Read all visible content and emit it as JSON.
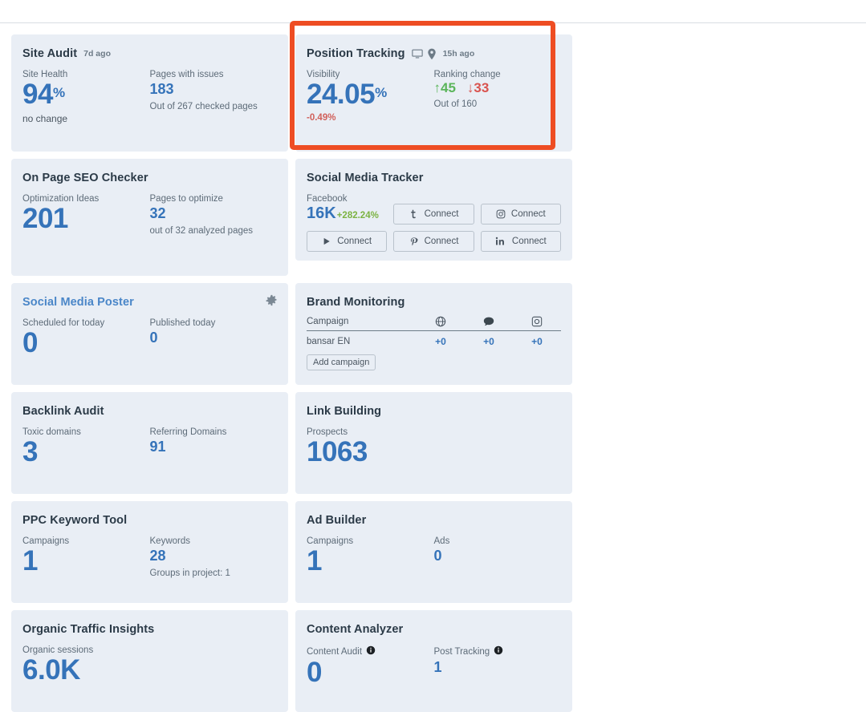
{
  "cards": [
    {
      "id": "site-audit",
      "title": "Site Audit",
      "meta": "7d ago",
      "metrics": [
        {
          "label": "Site Health",
          "value": "94",
          "unit": "%",
          "sub": "no change"
        },
        {
          "label": "Pages with issues",
          "value": "183",
          "sub": "Out of 267 checked pages"
        }
      ]
    },
    {
      "id": "position-tracking",
      "title": "Position Tracking",
      "meta": "15h ago",
      "icons": [
        "desktop-icon",
        "location-pin-icon"
      ],
      "metrics": [
        {
          "label": "Visibility",
          "value": "24.05",
          "unit": "%",
          "sub": "-0.49%"
        },
        {
          "label": "Ranking change",
          "up": "45",
          "down": "33",
          "sub": "Out of 160"
        }
      ]
    },
    {
      "id": "on-page-seo-checker",
      "title": "On Page SEO Checker",
      "metrics": [
        {
          "label": "Optimization Ideas",
          "value": "201"
        },
        {
          "label": "Pages to optimize",
          "value": "32",
          "sub": "out of 32 analyzed pages"
        }
      ]
    },
    {
      "id": "social-media-tracker",
      "title": "Social Media Tracker",
      "metrics": [
        {
          "label": "Facebook",
          "value": "16K",
          "delta": "+282.24%"
        }
      ],
      "connect_buttons": [
        {
          "icon": "twitter-icon",
          "label": "Connect"
        },
        {
          "icon": "instagram-icon",
          "label": "Connect"
        },
        {
          "icon": "youtube-icon",
          "label": "Connect"
        },
        {
          "icon": "pinterest-icon",
          "label": "Connect"
        },
        {
          "icon": "linkedin-icon",
          "label": "Connect"
        }
      ]
    },
    {
      "id": "social-media-poster",
      "title": "Social Media Poster",
      "gear": "gear-icon",
      "metrics": [
        {
          "label": "Scheduled for today",
          "value": "0"
        },
        {
          "label": "Published today",
          "value": "0"
        }
      ]
    },
    {
      "id": "brand-monitoring",
      "title": "Brand Monitoring",
      "table": {
        "headers": [
          "Campaign",
          "globe-icon",
          "comment-icon",
          "instagram-icon"
        ],
        "campaign_header": "Campaign",
        "rows": [
          {
            "name": "bansar EN",
            "values": [
              "+0",
              "+0",
              "+0"
            ]
          }
        ]
      },
      "add_button": "Add campaign"
    },
    {
      "id": "backlink-audit",
      "title": "Backlink Audit",
      "metrics": [
        {
          "label": "Toxic domains",
          "value": "3"
        },
        {
          "label": "Referring Domains",
          "value": "91"
        }
      ]
    },
    {
      "id": "link-building",
      "title": "Link Building",
      "metrics": [
        {
          "label": "Prospects",
          "value": "1063"
        }
      ]
    },
    {
      "id": "ppc-keyword-tool",
      "title": "PPC Keyword Tool",
      "metrics": [
        {
          "label": "Campaigns",
          "value": "1"
        },
        {
          "label": "Keywords",
          "value": "28",
          "sub": "Groups in project: 1"
        }
      ]
    },
    {
      "id": "ad-builder",
      "title": "Ad Builder",
      "metrics": [
        {
          "label": "Campaigns",
          "value": "1"
        },
        {
          "label": "Ads",
          "value": "0"
        }
      ]
    },
    {
      "id": "organic-traffic-insights",
      "title": "Organic Traffic Insights",
      "metrics": [
        {
          "label": "Organic sessions",
          "value": "6.0K"
        }
      ]
    },
    {
      "id": "content-analyzer",
      "title": "Content Analyzer",
      "metrics": [
        {
          "label": "Content Audit",
          "info": "info-icon",
          "value": "0"
        },
        {
          "label": "Post Tracking",
          "info": "info-icon",
          "value": "1"
        }
      ]
    }
  ],
  "colors": {
    "accent_blue": "#3573b9",
    "link_blue": "#4a86c8",
    "card_bg": "#e9eef5",
    "positive_green": "#5bb55b",
    "negative_red": "#d9534f",
    "delta_green": "#7cb342",
    "highlight_orange": "#ee4d23"
  }
}
